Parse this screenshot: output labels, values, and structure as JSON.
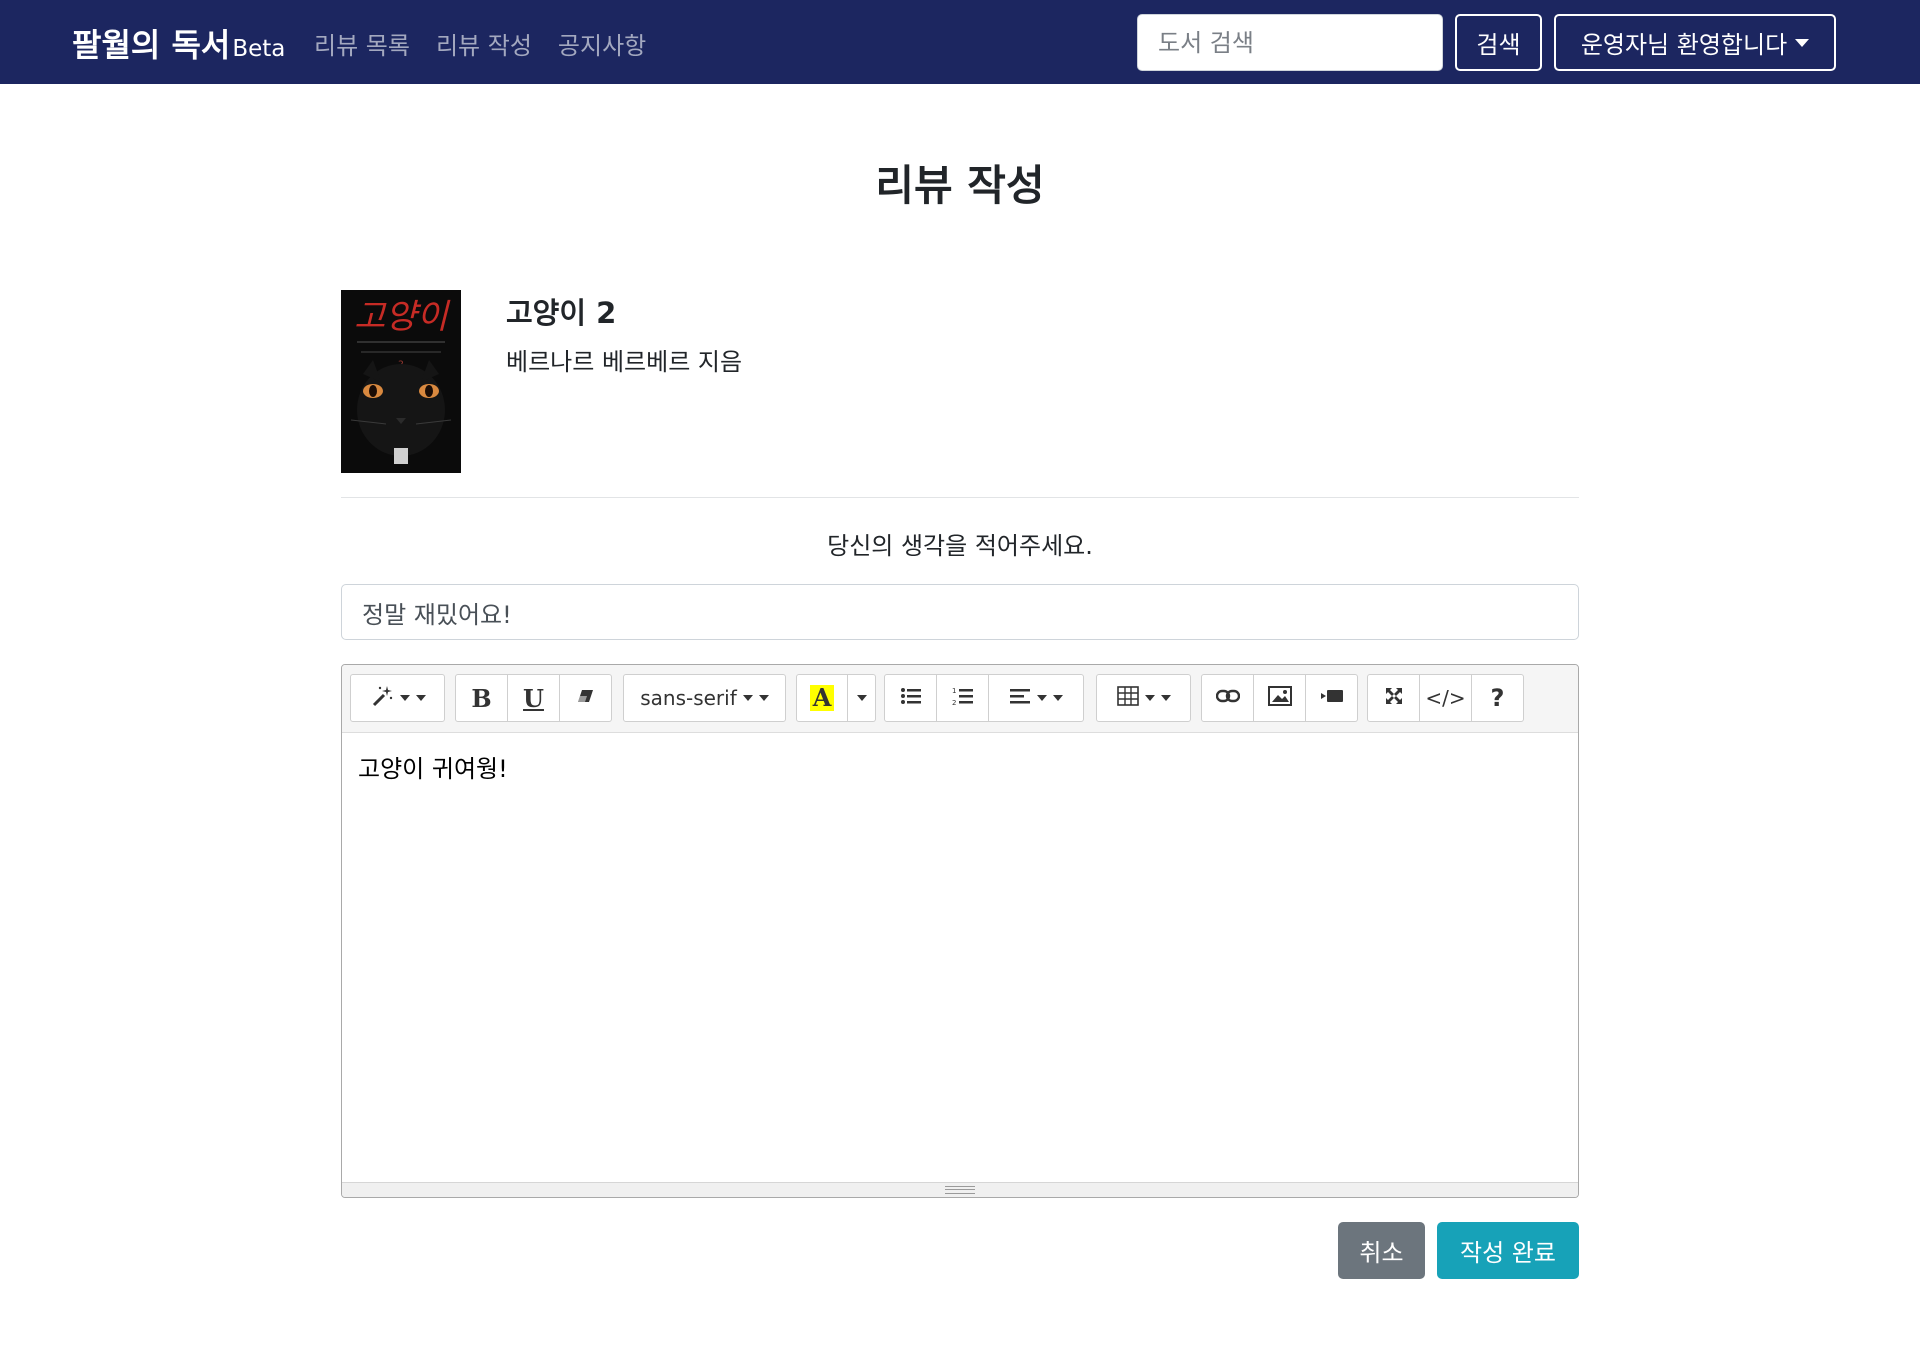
{
  "navbar": {
    "brand": "팔월의 독서",
    "brand_suffix": "Beta",
    "links": [
      "리뷰 목록",
      "리뷰 작성",
      "공지사항"
    ],
    "search_placeholder": "도서 검색",
    "search_button": "검색",
    "user_menu": "운영자님 환영합니다"
  },
  "page": {
    "title": "리뷰 작성"
  },
  "book": {
    "title": "고양이 2",
    "author": "베르나르 베르베르 지음",
    "cover": {
      "title_text": "고양이",
      "volume": "2"
    }
  },
  "review": {
    "prompt": "당신의 생각을 적어주세요.",
    "title_value": "정말 재밌어요!",
    "body": "고양이 귀여웡!"
  },
  "editor": {
    "font_family": "sans-serif",
    "toolbar_icons": [
      "magic-icon",
      "bold-icon",
      "underline-icon",
      "eraser-icon",
      "font-color-icon",
      "bullet-list-icon",
      "ordered-list-icon",
      "align-icon",
      "table-icon",
      "link-icon",
      "picture-icon",
      "video-icon",
      "fullscreen-icon",
      "code-view-icon",
      "help-icon"
    ]
  },
  "actions": {
    "cancel": "취소",
    "submit": "작성 완료"
  },
  "colors": {
    "navbar": "#1c2660",
    "cancel": "#6c757d",
    "submit": "#17a2b8",
    "highlight": "#ffff00"
  }
}
